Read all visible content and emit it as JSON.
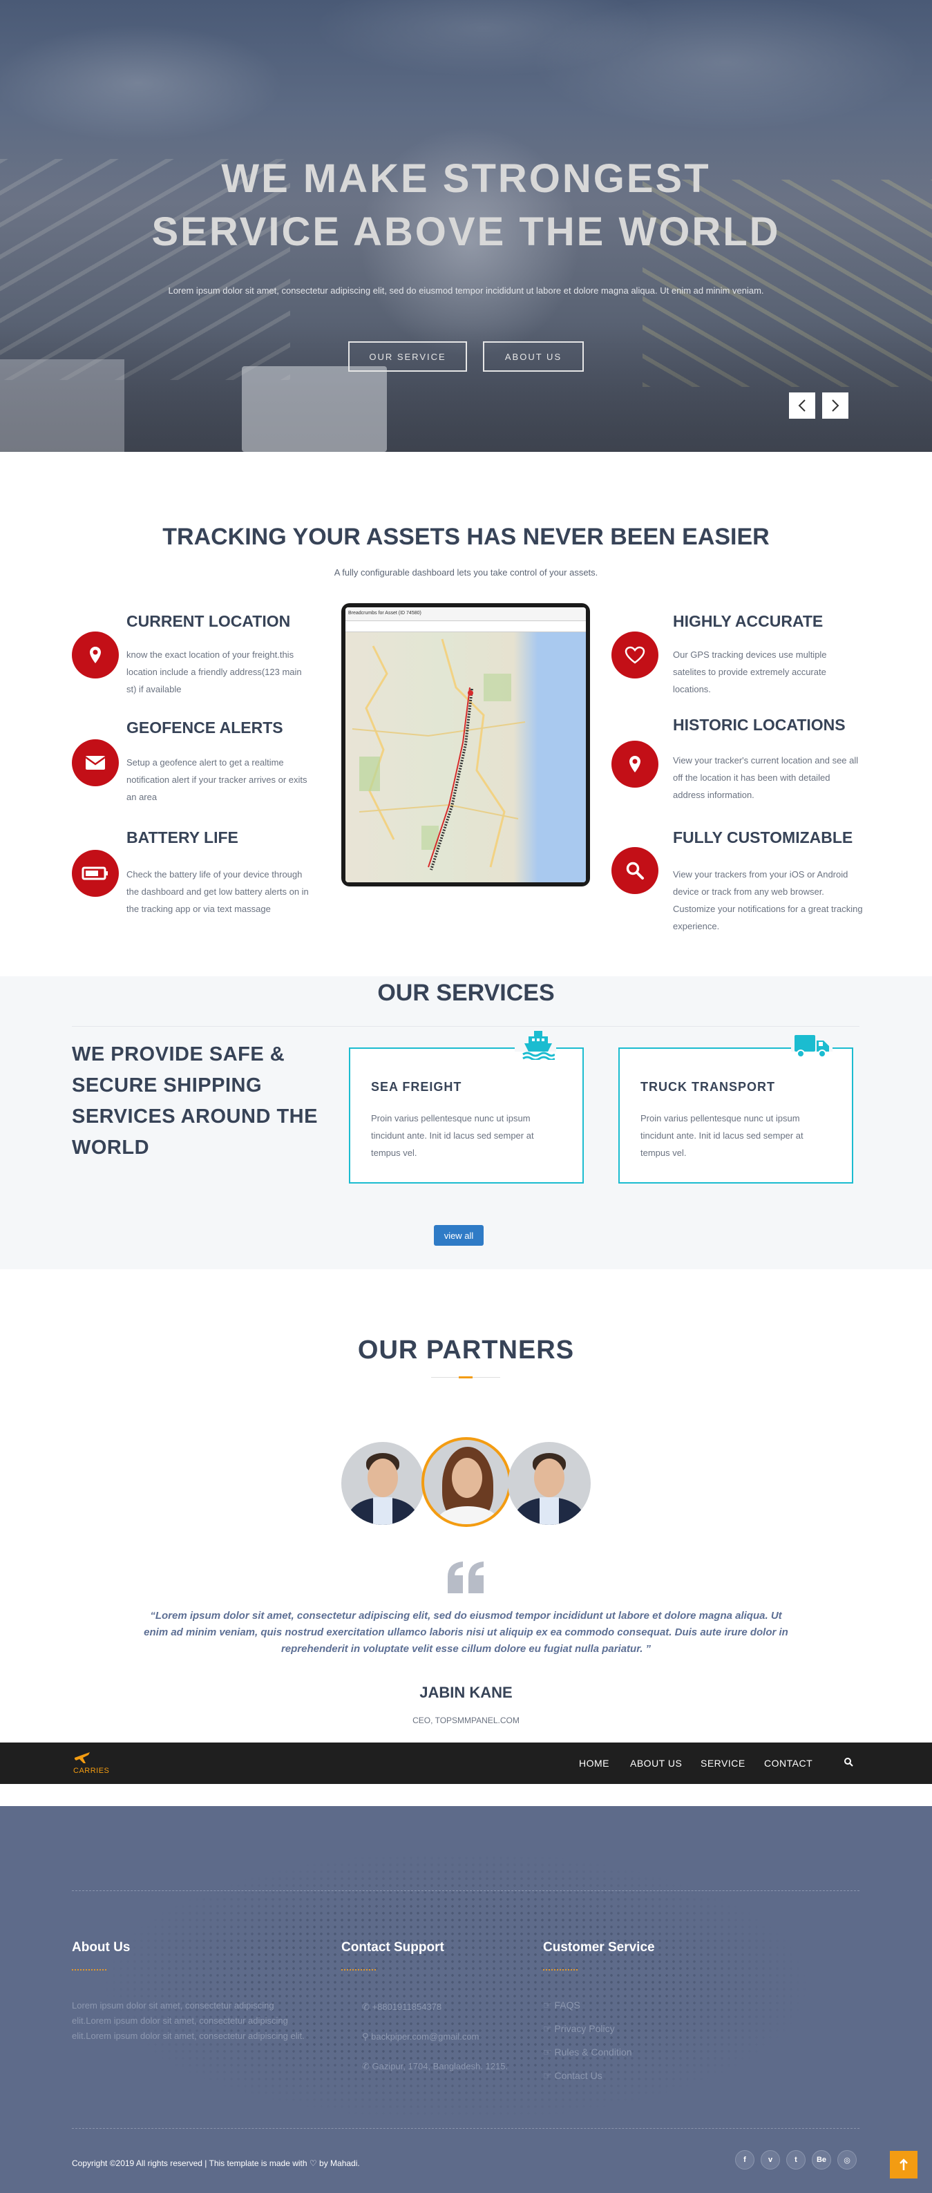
{
  "hero": {
    "title_line1": "WE MAKE STRONGEST",
    "title_line2": "SERVICE ABOVE THE WORLD",
    "subtitle": "Lorem ipsum dolor sit amet, consectetur adipiscing elit, sed do eiusmod tempor incididunt ut labore et dolore magna aliqua. Ut enim ad minim veniam.",
    "btn_service": "OUR SERVICE",
    "btn_about": "ABOUT US",
    "prev_icon": "chevron-left-icon",
    "next_icon": "chevron-right-icon"
  },
  "tracking": {
    "title": "TRACKING YOUR ASSETS HAS NEVER BEEN EASIER",
    "subtitle": "A fully configurable dashboard lets you take control of your assets.",
    "features_left": [
      {
        "title": "CURRENT LOCATION",
        "text": "know the exact location of your freight.this location include a friendly address(123 main st) if available",
        "icon": "map-marker-icon"
      },
      {
        "title": "GEOFENCE ALERTS",
        "text": "Setup a geofence alert to get a realtime notification alert if your tracker arrives or exits an area",
        "icon": "envelope-icon"
      },
      {
        "title": "BATTERY LIFE",
        "text": "Check the battery life of your device through the dashboard and get low battery alerts on in the tracking app or via text massage",
        "icon": "battery-icon"
      }
    ],
    "features_right": [
      {
        "title": "HIGHLY ACCURATE",
        "text": "Our GPS tracking devices use multiple satelites to provide extremely accurate locations.",
        "icon": "heart-icon"
      },
      {
        "title": "HISTORIC LOCATIONS",
        "text": "View your tracker's current location and see all off the location it has been with detailed address information.",
        "icon": "map-marker-icon"
      },
      {
        "title": "FULLY CUSTOMIZABLE",
        "text": "View your trackers from your iOS or Android device or track from any web browser. Customize your notifications for a great tracking experience.",
        "icon": "search-icon"
      }
    ],
    "map_header": "Breadcrumbs for Asset (ID 74580)"
  },
  "services": {
    "title": "OUR SERVICES",
    "lead": "WE PROVIDE SAFE & SECURE SHIPPING SERVICES AROUND THE WORLD",
    "cards": [
      {
        "title": "SEA FREIGHT",
        "text": "Proin varius pellentesque nunc ut ipsum tincidunt ante. Init id lacus sed semper at tempus vel.",
        "icon": "ship-icon"
      },
      {
        "title": "TRUCK TRANSPORT",
        "text": "Proin varius pellentesque nunc ut ipsum tincidunt ante. Init id lacus sed semper at tempus vel.",
        "icon": "truck-icon"
      }
    ],
    "view_all": "view all"
  },
  "partners": {
    "title": "OUR PARTNERS",
    "quote": "“Lorem ipsum dolor sit amet, consectetur adipiscing elit, sed do eiusmod tempor incididunt ut labore et dolore magna aliqua. Ut enim ad minim veniam, quis nostrud exercitation ullamco laboris nisi ut aliquip ex ea commodo consequat. Duis aute irure dolor in reprehenderit in voluptate velit esse cillum dolore eu fugiat nulla pariatur. ”",
    "name": "JABIN KANE",
    "role": "CEO, TOPSMMPANEL.COM",
    "accent_color": "#f39c12"
  },
  "navbar": {
    "logo_text": "CARRIES",
    "logo_icon": "airplane-icon",
    "items": [
      "HOME",
      "ABOUT US",
      "SERVICE",
      "CONTACT"
    ],
    "search_icon": "search-icon"
  },
  "footer": {
    "about_title": "About Us",
    "about_text": "Lorem ipsum dolor sit amet, consectetur adipiscing elit.Lorem ipsum dolor sit amet, consectetur adipiscing elit.Lorem ipsum dolor sit amet, consectetur adipiscing elit.",
    "contact_title": "Contact Support",
    "phone": "+8801911854378",
    "email": "backpiper.com@gmail.com",
    "address": "Gazipur, 1704, Bangladesh. 1215.",
    "service_title": "Customer Service",
    "links": [
      "FAQS",
      "Privacy Policy",
      "Rules & Condition",
      "Contact Us"
    ],
    "copyright_pre": "Copyright ©2019 All rights reserved | This template is made with",
    "copyright_post": "by Mahadi.",
    "socials": [
      "f",
      "v",
      "t",
      "Be",
      "◎"
    ],
    "back_to_top_icon": "arrow-up-icon"
  },
  "colors": {
    "brand_red": "#c30f17",
    "accent_cyan": "#1bbcd0",
    "accent_orange": "#f39c12",
    "dark_navy": "#374357"
  }
}
